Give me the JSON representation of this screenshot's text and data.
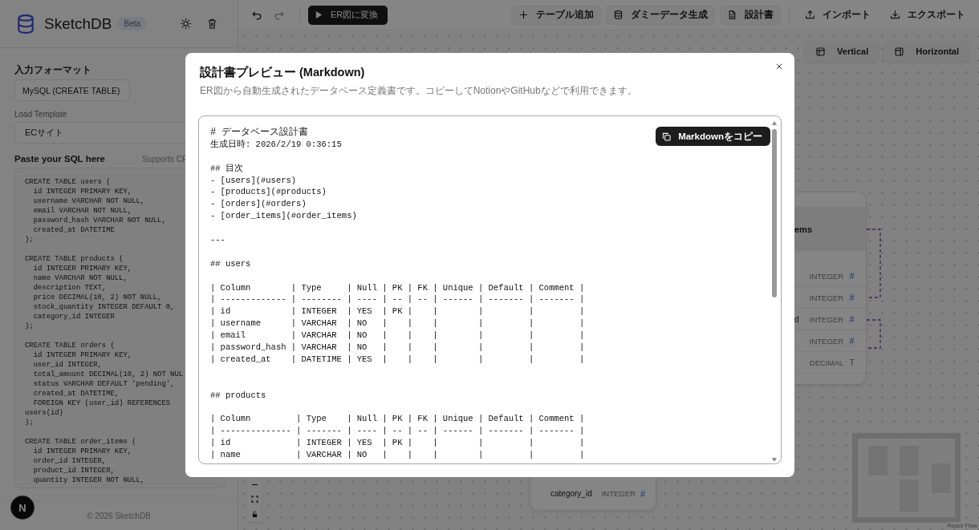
{
  "sidebar": {
    "app_name": "SketchDB",
    "badge": "Beta",
    "format_label": "入力フォーマット",
    "format_value": "MySQL (CREATE TABLE)",
    "template_label": "Load Template",
    "template_value": "ECサイト",
    "sql_label": "Paste your SQL here",
    "sql_hint": "Supports CF",
    "sql": "CREATE TABLE users (\n  id INTEGER PRIMARY KEY,\n  username VARCHAR NOT NULL,\n  email VARCHAR NOT NULL,\n  password_hash VARCHAR NOT NULL,\n  created_at DATETIME\n);\n\nCREATE TABLE products (\n  id INTEGER PRIMARY KEY,\n  name VARCHAR NOT NULL,\n  description TEXT,\n  price DECIMAL(10, 2) NOT NULL,\n  stock_quantity INTEGER DEFAULT 0,\n  category_id INTEGER\n);\n\nCREATE TABLE orders (\n  id INTEGER PRIMARY KEY,\n  user_id INTEGER,\n  total_amount DECIMAL(10, 2) NOT NUL\n  status VARCHAR DEFAULT 'pending',\n  created_at DATETIME,\n  FOREIGN KEY (user_id) REFERENCES users(id)\n);\n\nCREATE TABLE order_items (\n  id INTEGER PRIMARY KEY,\n  order_id INTEGER,\n  product_id INTEGER,\n  quantity INTEGER NOT NULL,",
    "footer": "© 2026 SketchDB"
  },
  "toolbar": {
    "convert_button": "ER図に変換",
    "actions": [
      {
        "label": "テーブル追加",
        "kind": "plus"
      },
      {
        "label": "ダミーデータ生成",
        "kind": "database"
      },
      {
        "label": "設計書",
        "kind": "document"
      }
    ],
    "transfer": [
      {
        "label": "インポート",
        "kind": "upload"
      },
      {
        "label": "エクスポート",
        "kind": "download"
      }
    ]
  },
  "layout_buttons": [
    {
      "label": "Vertical",
      "kind": "rows"
    },
    {
      "label": "Horizontal",
      "kind": "columns"
    }
  ],
  "canvas": {
    "nodes": [
      {
        "title": "ems",
        "rows": [
          {
            "type": "INTEGER",
            "mark": "#",
            "kind": "number"
          },
          {
            "type": "INTEGER",
            "mark": "#",
            "kind": "number"
          },
          {
            "name": "d",
            "type": "INTEGER",
            "mark": "#",
            "kind": "number"
          },
          {
            "type": "INTEGER",
            "mark": "#",
            "kind": "number"
          },
          {
            "type": "DECIMAL",
            "mark": "T",
            "kind": "text"
          }
        ]
      },
      {
        "rows": [
          {
            "name": "category_id",
            "type": "INTEGER",
            "mark": "#",
            "kind": "number"
          }
        ]
      }
    ],
    "attribution": "React Flow"
  },
  "dev_indicator": "N",
  "modal": {
    "title": "設計書プレビュー (Markdown)",
    "subtitle": "ER図から自動生成されたデータベース定義書です。コピーしてNotionやGitHubなどで利用できます。",
    "copy_button": "Markdownをコピー",
    "markdown": [
      {
        "kind": "text",
        "text": "# データベース設計書"
      },
      {
        "kind": "text",
        "text": "生成日時: 2026/2/19 0:36:15"
      },
      {
        "kind": "blank"
      },
      {
        "kind": "text",
        "text": "## 目次"
      },
      {
        "kind": "text",
        "text": "- [users](#users)"
      },
      {
        "kind": "text",
        "text": "- [products](#products)"
      },
      {
        "kind": "text",
        "text": "- [orders](#orders)"
      },
      {
        "kind": "text",
        "text": "- [order_items](#order_items)"
      },
      {
        "kind": "blank"
      },
      {
        "kind": "text",
        "text": "---"
      },
      {
        "kind": "blank"
      },
      {
        "kind": "text",
        "text": "## users"
      },
      {
        "kind": "blank"
      },
      {
        "kind": "text",
        "text": "| Column        | Type     | Null | PK | FK | Unique | Default | Comment |"
      },
      {
        "kind": "text",
        "text": "| ------------- | -------- | ---- | -- | -- | ------ | ------- | ------- |"
      },
      {
        "kind": "text",
        "text": "| id            | INTEGER  | YES  | PK |    |        |         |         |"
      },
      {
        "kind": "text",
        "text": "| username      | VARCHAR  | NO   |    |    |        |         |         |"
      },
      {
        "kind": "text",
        "text": "| email         | VARCHAR  | NO   |    |    |        |         |         |"
      },
      {
        "kind": "text",
        "text": "| password_hash | VARCHAR  | NO   |    |    |        |         |         |"
      },
      {
        "kind": "text",
        "text": "| created_at    | DATETIME | YES  |    |    |        |         |         |"
      },
      {
        "kind": "blank"
      },
      {
        "kind": "blank"
      },
      {
        "kind": "text",
        "text": "## products"
      },
      {
        "kind": "blank"
      },
      {
        "kind": "text",
        "text": "| Column         | Type    | Null | PK | FK | Unique | Default | Comment |"
      },
      {
        "kind": "text",
        "text": "| -------------- | ------- | ---- | -- | -- | ------ | ------- | ------- |"
      },
      {
        "kind": "text",
        "text": "| id             | INTEGER | YES  | PK |    |        |         |         |"
      },
      {
        "kind": "text",
        "text": "| name           | VARCHAR | NO   |    |    |        |         |         |"
      }
    ]
  }
}
